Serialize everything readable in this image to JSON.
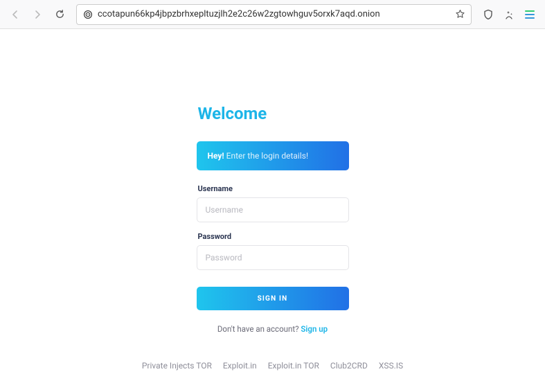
{
  "browser": {
    "url": "ccotapun66kp4jbpzbrhxepltuzjlh2e2c26w2zgtowhguv5orxk7aqd.onion"
  },
  "page": {
    "title": "Welcome",
    "banner": {
      "bold": "Hey!",
      "text": "Enter the login details!"
    },
    "form": {
      "username_label": "Username",
      "username_placeholder": "Username",
      "password_label": "Password",
      "password_placeholder": "Password",
      "signin_button": "SIGN IN"
    },
    "signup": {
      "prompt": "Don't have an account? ",
      "link_text": "Sign up"
    },
    "footer_links": [
      "Private Injects TOR",
      "Exploit.in",
      "Exploit.in TOR",
      "Club2CRD",
      "XSS.IS"
    ]
  }
}
